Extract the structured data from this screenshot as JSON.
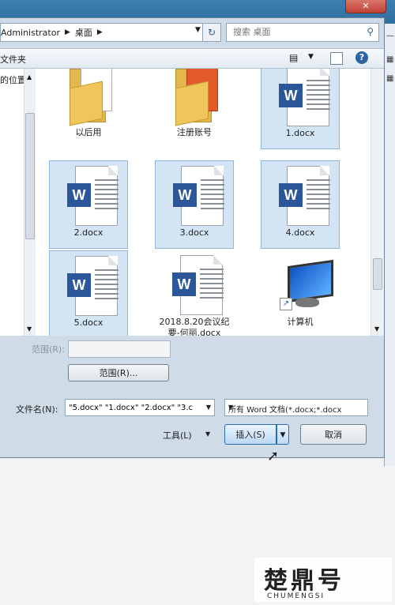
{
  "topbar": {
    "close_glyph": "✕"
  },
  "address": {
    "path": [
      "Administrator",
      "桌面"
    ],
    "refresh_glyph": "↻"
  },
  "search": {
    "placeholder": "搜索 桌面"
  },
  "toolbar": {
    "new_folder": "文件夹"
  },
  "nav": {
    "truncated_item": "的位置"
  },
  "files": [
    {
      "name": "以后用",
      "type": "folder",
      "selected": false
    },
    {
      "name": "注册账号",
      "type": "folder",
      "selected": false
    },
    {
      "name": "1.docx",
      "type": "word",
      "selected": true
    },
    {
      "name": "2.docx",
      "type": "word",
      "selected": true
    },
    {
      "name": "3.docx",
      "type": "word",
      "selected": true
    },
    {
      "name": "4.docx",
      "type": "word",
      "selected": true
    },
    {
      "name": "5.docx",
      "type": "word",
      "selected": true
    },
    {
      "name": "2018.8.20会议纪要-何丽.docx",
      "name_line1": "2018.8.20会议纪",
      "name_line2": "要-何丽.docx",
      "type": "word",
      "selected": false
    },
    {
      "name": "计算机",
      "type": "computer",
      "selected": false
    }
  ],
  "form": {
    "range_label": "范围(R):",
    "range_button": "范围(R)...",
    "filename_label": "文件名(N):",
    "filename_value": "\"5.docx\" \"1.docx\" \"2.docx\" \"3.c",
    "filetype_value": "所有 Word 文档(*.docx;*.docx",
    "tools_label": "工具(L)",
    "insert_button": "插入(S)",
    "cancel_button": "取消"
  },
  "watermark": {
    "text": "楚鼎号",
    "sub": "CHUMENGSI"
  }
}
